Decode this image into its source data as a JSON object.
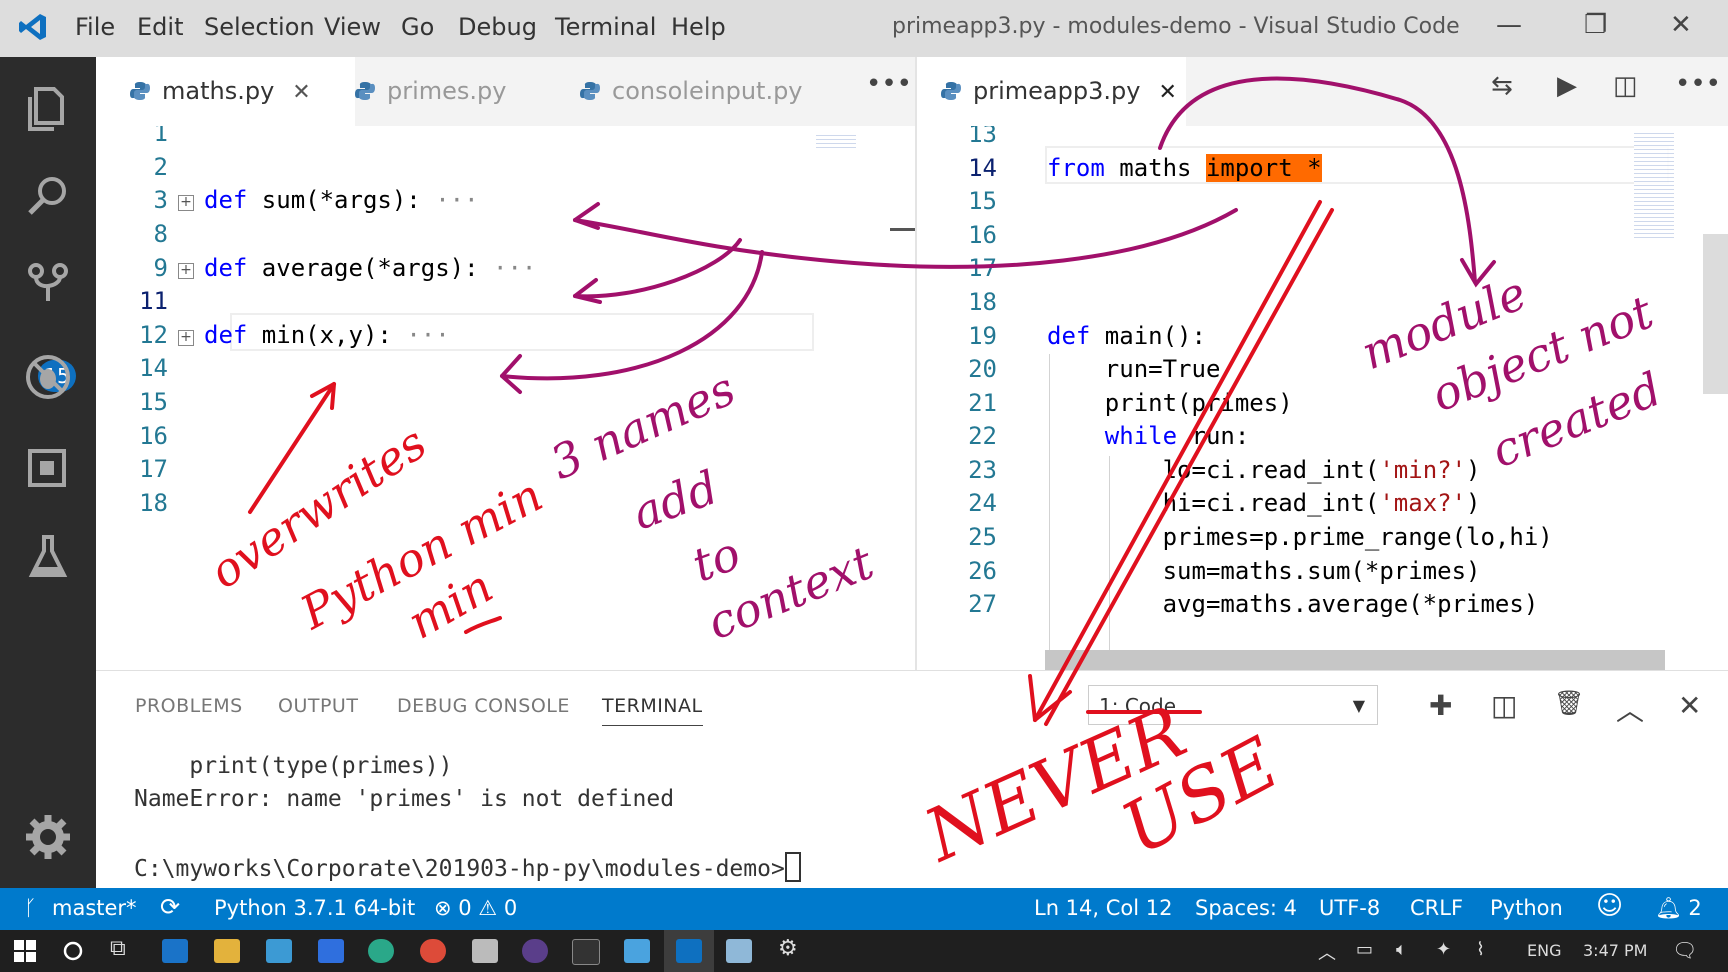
{
  "titlebar": {
    "menu": [
      "File",
      "Edit",
      "Selection",
      "View",
      "Go",
      "Debug",
      "Terminal",
      "Help"
    ],
    "window_title": "primeapp3.py - modules-demo - Visual Studio Code",
    "controls": {
      "minimize": "—",
      "restore": "❐",
      "close": "✕"
    }
  },
  "activity_bar": {
    "items": [
      "explorer-icon",
      "search-icon",
      "source-control-icon",
      "debug-icon",
      "extensions-icon",
      "test-icon"
    ],
    "scm_badge": "15",
    "settings": "gear-icon"
  },
  "left_editor": {
    "tabs": [
      {
        "label": "maths.py",
        "active": true,
        "close": "✕"
      },
      {
        "label": "primes.py",
        "active": false
      },
      {
        "label": "consoleinput.py",
        "active": false
      }
    ],
    "more": "•••",
    "lines": [
      {
        "num": "1",
        "code": ""
      },
      {
        "num": "2",
        "code": ""
      },
      {
        "num": "3",
        "kw": "def",
        "rest": " sum(*args):",
        "folded": true,
        "ellipsis": "···"
      },
      {
        "num": "8",
        "code": ""
      },
      {
        "num": "9",
        "kw": "def",
        "rest": " average(*args):",
        "folded": true,
        "ellipsis": "···"
      },
      {
        "num": "11",
        "code": "",
        "current": true
      },
      {
        "num": "12",
        "kw": "def",
        "rest": " min(x,y):",
        "folded": true,
        "ellipsis": "···"
      },
      {
        "num": "14",
        "code": ""
      },
      {
        "num": "15",
        "code": ""
      },
      {
        "num": "16",
        "code": ""
      },
      {
        "num": "17",
        "code": ""
      },
      {
        "num": "18",
        "code": ""
      }
    ]
  },
  "right_editor": {
    "tab": {
      "label": "primeapp3.py",
      "close": "✕"
    },
    "toolbar": {
      "compare": "⇆",
      "run": "▶",
      "split": "◫",
      "more": "•••"
    },
    "lines": [
      {
        "num": "13"
      },
      {
        "num": "14",
        "kw": "from",
        "mid": " maths ",
        "hl": "import *"
      },
      {
        "num": "15"
      },
      {
        "num": "16"
      },
      {
        "num": "17"
      },
      {
        "num": "18"
      },
      {
        "num": "19",
        "kw": "def",
        "rest": " main():"
      },
      {
        "num": "20",
        "text": "    run=True"
      },
      {
        "num": "21",
        "text": "    print(primes)"
      },
      {
        "num": "22",
        "kw_indent": "    ",
        "kw": "while",
        "rest": " run:"
      },
      {
        "num": "23",
        "pre": "        lo=ci.read_int(",
        "str": "'min?'",
        "post": ")"
      },
      {
        "num": "24",
        "pre": "        hi=ci.read_int(",
        "str": "'max?'",
        "post": ")"
      },
      {
        "num": "25",
        "text": "        primes=p.prime_range(lo,hi)"
      },
      {
        "num": "26",
        "text": "        sum=maths.sum(*primes)"
      },
      {
        "num": "27",
        "text": "        avg=maths.average(*primes)"
      }
    ]
  },
  "panel": {
    "tabs": [
      "PROBLEMS",
      "OUTPUT",
      "DEBUG CONSOLE",
      "TERMINAL"
    ],
    "active_tab": "TERMINAL",
    "terminal_select": "1: Code",
    "select_arrow": "▼",
    "tools": {
      "add": "✚",
      "split": "◫",
      "trash": "🗑",
      "maximize": "︿",
      "close": "✕"
    },
    "terminal_lines": [
      "    print(type(primes))",
      "NameError: name 'primes' is not defined",
      "",
      "C:\\myworks\\Corporate\\201903-hp-py\\modules-demo>"
    ]
  },
  "statusbar": {
    "branch": "master*",
    "sync": "⟳",
    "interpreter": "Python 3.7.1 64-bit",
    "errors": "0",
    "warnings": "0",
    "position": "Ln 14, Col 12",
    "spaces": "Spaces: 4",
    "encoding": "UTF-8",
    "eol": "CRLF",
    "language": "Python",
    "notifications": "2"
  },
  "taskbar": {
    "language": "ENG",
    "time": "3:47 PM"
  },
  "annotations": {
    "overwrites": "overwrites",
    "python_min": "Python min",
    "min": "min",
    "three_names": "3 names",
    "add": "add",
    "to": "to",
    "context": "context",
    "module": "module",
    "object_not": "object not",
    "created": "created",
    "never": "NEVER",
    "use": "USE"
  },
  "colors": {
    "accent": "#007acc",
    "annotation_magenta": "#a1106b",
    "annotation_red": "#e0101e",
    "highlight": "#ff6a00"
  }
}
